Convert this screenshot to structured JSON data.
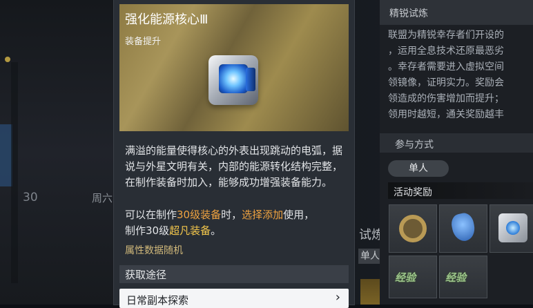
{
  "background": {
    "left_number": "30",
    "left_week": "周六",
    "mid_title": "试炼",
    "mid_tag": "单人"
  },
  "right_panel": {
    "title": "精锐试炼",
    "description_lines": [
      "联盟为精锐幸存者们开设的",
      "，运用全息技术还原最恶劣",
      "。幸存者需要进入虚拟空间",
      "领镜像，证明实力。奖励会",
      "领造成的伤害增加而提升；",
      "领用时越短，通关奖励越丰"
    ],
    "participation_label": "参与方式",
    "mode": "单人",
    "rewards_label": "活动奖励",
    "reward_slot_texts": [
      "经验",
      "经验"
    ]
  },
  "item_card": {
    "title": "强化能源核心Ⅲ",
    "subtitle": "装备提升",
    "description": "满溢的能量使得核心的外表出现跳动的电弧，据说与外星文明有关，内部的能源转化结构完整，在制作装备时加入，能够成功增强装备能力。",
    "usage": {
      "prefix": "可以在制作",
      "level_gear": "30级装备",
      "middle": "时，",
      "action": "选择添加",
      "after_action": "使用，",
      "line2_prefix": "制作30级",
      "result_gear": "超凡装备",
      "suffix": "。"
    },
    "attr_note": "属性数据随机",
    "source_label": "获取途径",
    "source_button": "日常副本探索",
    "source_arrow": "›"
  },
  "colors": {
    "highlight_orange": "#f0a340",
    "highlight_yellow": "#f5c84c",
    "card_bg": "#292e35"
  }
}
